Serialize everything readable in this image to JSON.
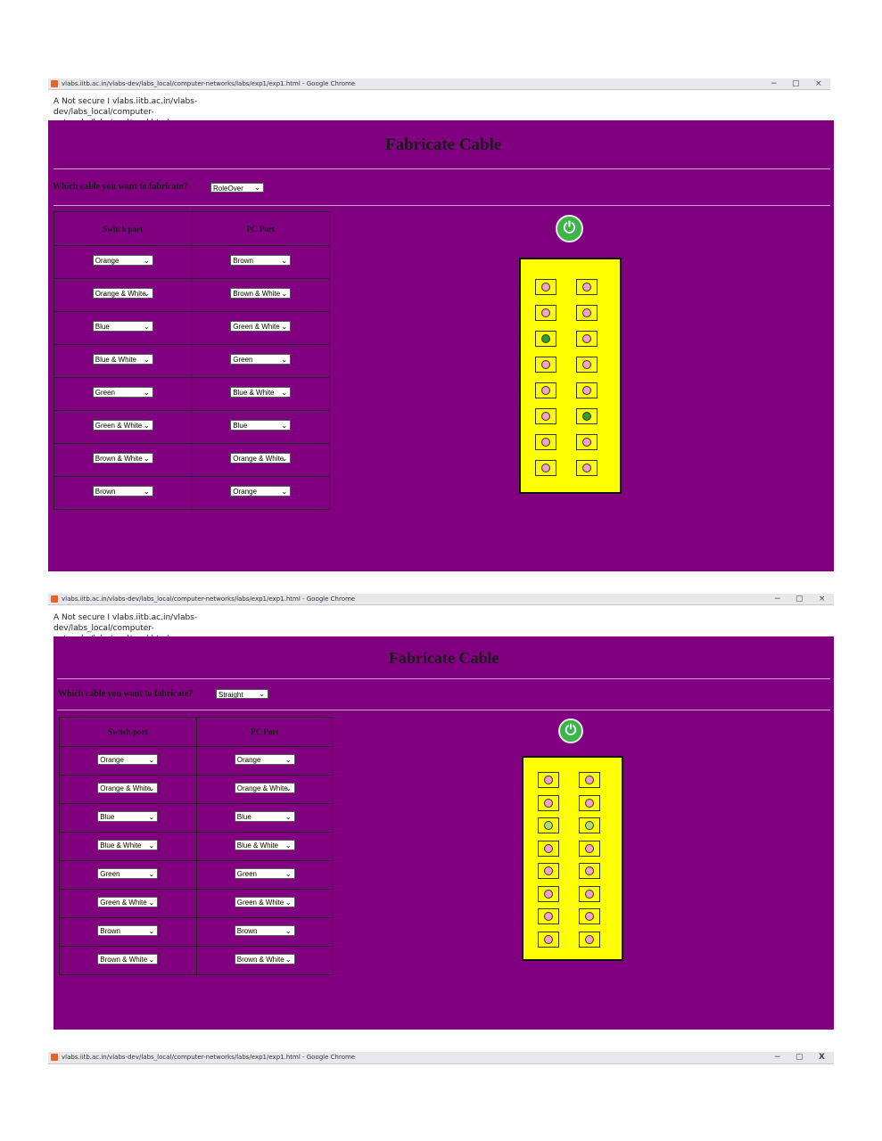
{
  "windows": [
    {
      "chrome_title": "vlabs.iitb.ac.in/vlabs-dev/labs_local/computer-networks/labs/exp1/exp1.html - Google Chrome",
      "address_line1": "A Not secure I vlabs.iitb.ac.in/vlabs-dev/labs_local/computer-",
      "address_line2": "networks/labs/expl/expl.html",
      "heading": "Fabricate Cable",
      "question": "Which cable you want to fabricate?",
      "cable_type": "RoleOver",
      "col_switch": "Switch port",
      "col_pc": "PC Port",
      "rows": [
        {
          "switch": "Orange",
          "pc": "Brown"
        },
        {
          "switch": "Orange & White",
          "pc": "Brown & White"
        },
        {
          "switch": "Blue",
          "pc": "Green & White"
        },
        {
          "switch": "Blue & White",
          "pc": "Green"
        },
        {
          "switch": "Green",
          "pc": "Blue & White"
        },
        {
          "switch": "Green & White",
          "pc": "Blue"
        },
        {
          "switch": "Brown & White",
          "pc": "Orange & White"
        },
        {
          "switch": "Brown",
          "pc": "Orange"
        }
      ],
      "power_icon": "power-icon",
      "pins_left": [
        "#f4a0c8",
        "#f4a0c8",
        "#2e9e2e",
        "#f4a0c8",
        "#f4a0c8",
        "#f4a0c8",
        "#f4a0c8",
        "#f4a0c8"
      ],
      "pins_right": [
        "#f4a0c8",
        "#f4a0c8",
        "#f4a0c8",
        "#f4a0c8",
        "#f4a0c8",
        "#2e9e2e",
        "#f4a0c8",
        "#f4a0c8"
      ]
    },
    {
      "chrome_title": "vlabs.iitb.ac.in/vlabs-dev/labs_local/computer-networks/labs/exp1/exp1.html - Google Chrome",
      "address_line1": "A Not secure I vlabs.iitb.ac.in/vlabs-dev/labs_local/computer-",
      "address_line2": "networks/labs/expl/expl.html",
      "heading": "Fabricate Cable",
      "question": "Which cable you want to fabricate?",
      "cable_type": "Straight",
      "col_switch": "Switch port",
      "col_pc": "PC Port",
      "rows": [
        {
          "switch": "Orange",
          "pc": "Orange"
        },
        {
          "switch": "Orange & White",
          "pc": "Orange & White"
        },
        {
          "switch": "Blue",
          "pc": "Blue"
        },
        {
          "switch": "Blue & White",
          "pc": "Blue & White"
        },
        {
          "switch": "Green",
          "pc": "Green"
        },
        {
          "switch": "Green & White",
          "pc": "Green & White"
        },
        {
          "switch": "Brown",
          "pc": "Brown"
        },
        {
          "switch": "Brown & White",
          "pc": "Brown & White"
        }
      ],
      "power_icon": "power-icon",
      "pins_left": [
        "#f4a0c8",
        "#f4a0c8",
        "#a8e070",
        "#f4a0c8",
        "#f4a0c8",
        "#f4a0c8",
        "#f4a0c8",
        "#f4a0c8"
      ],
      "pins_right": [
        "#f4a0c8",
        "#f4a0c8",
        "#a8e070",
        "#f4a0c8",
        "#f4a0c8",
        "#f4a0c8",
        "#f4a0c8",
        "#f4a0c8"
      ]
    }
  ],
  "footer_bar": {
    "title": "vlabs.iitb.ac.in/vlabs-dev/labs_local/computer-networks/labs/exp1/exp1.html - Google Chrome",
    "close_label": "X"
  },
  "window_controls": {
    "minimize": "−",
    "restore": "▢",
    "close": "×"
  },
  "dropdown_arrow": "⌄",
  "power_glyph": "⏻"
}
